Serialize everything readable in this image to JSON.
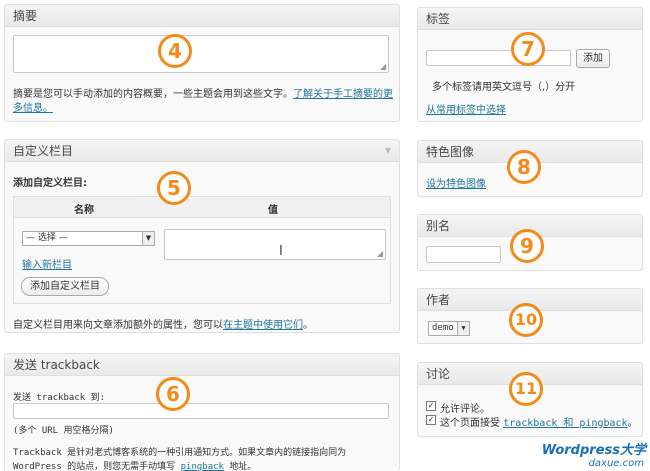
{
  "excerpt": {
    "title": "摘要",
    "help_text": "摘要是您可以手动添加的内容概要，一些主题会用到这些文字。",
    "help_link": "了解关于手工摘要的更",
    "help_link_2": "多信息。"
  },
  "custom_fields": {
    "title": "自定义栏目",
    "add_heading": "添加自定义栏目:",
    "col_name": "名称",
    "col_value": "值",
    "select_value": "— 选择 —",
    "enter_new": "输入新栏目",
    "add_button": "添加自定义栏目",
    "footer_text": "自定义栏目用来向文章添加额外的属性，您可以",
    "footer_link": "在主题中使用它们",
    "footer_end": "。"
  },
  "trackback": {
    "title": "发送 trackback",
    "label": "发送 trackback 到:",
    "hint": "(多个 URL 用空格分隔)",
    "desc_1": "Trackback 是针对老式博客系统的一种引用通知方式。如果文章内的链接指向同为",
    "desc_2a": "WordPress 的站点，则您无需手动填写 ",
    "desc_link": "pingback",
    "desc_2b": " 地址。"
  },
  "tags": {
    "title": "标签",
    "add_button": "添加",
    "hint": "多个标签请用英文逗号（,）分开",
    "choose_link": "从常用标签中选择"
  },
  "featured_image": {
    "title": "特色图像",
    "set_link": "设为特色图像"
  },
  "slug": {
    "title": "别名"
  },
  "author": {
    "title": "作者",
    "selected": "demo"
  },
  "discussion": {
    "title": "讨论",
    "allow_comments": "允许评论。",
    "allow_pings_prefix": "这个页面接受 ",
    "allow_pings_link": "trackback 和 pingback",
    "allow_pings_suffix": "。"
  },
  "badges": [
    "4",
    "5",
    "6",
    "7",
    "8",
    "9",
    "10",
    "11"
  ],
  "watermark": {
    "line1": "Wordpress大学",
    "line2": "daxue.com"
  },
  "colors": {
    "badge": "#f48a1a",
    "link": "#21759b",
    "watermark": "#1b6fb8"
  }
}
